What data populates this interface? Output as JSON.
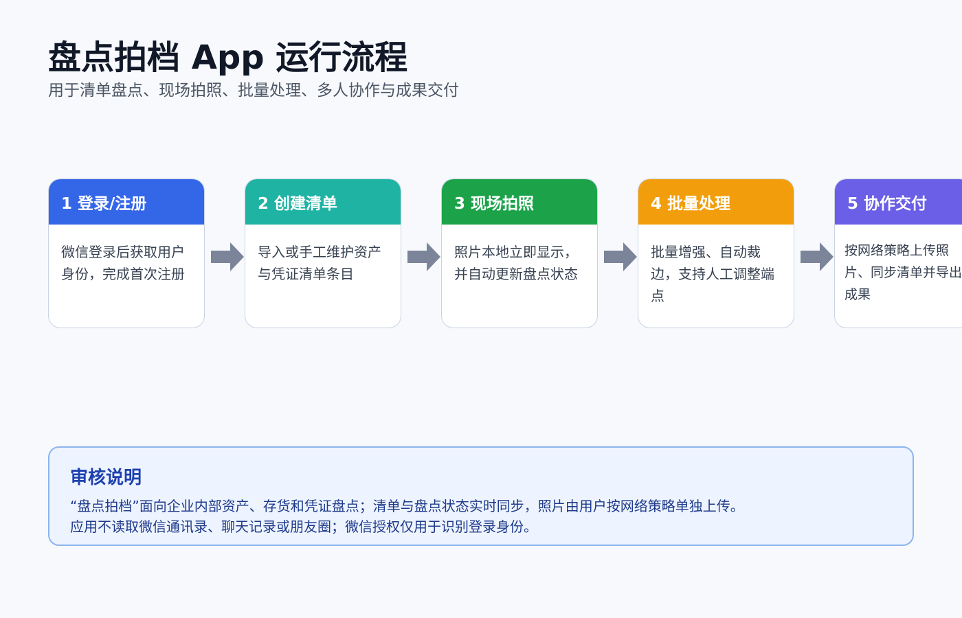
{
  "header": {
    "title": "盘点拍档 App 运行流程",
    "subtitle": "用于清单盘点、现场拍照、批量处理、多人协作与成果交付"
  },
  "steps": [
    {
      "label": "1 登录/注册",
      "desc": "微信登录后获取用户身份，完成首次注册",
      "color": "#3466e8"
    },
    {
      "label": "2 创建清单",
      "desc": "导入或手工维护资产与凭证清单条目",
      "color": "#1fb3a3"
    },
    {
      "label": "3 现场拍照",
      "desc": "照片本地立即显示，并自动更新盘点状态",
      "color": "#1ca34a"
    },
    {
      "label": "4 批量处理",
      "desc": "批量增强、自动裁边，支持人工调整端点",
      "color": "#f29e0c"
    },
    {
      "label": "5 协作交付",
      "desc": "按网络策略上传照片、同步清单并导出成果",
      "color": "#6a5fe6"
    }
  ],
  "arrow_color": "#7b8499",
  "review": {
    "title": "审核说明",
    "line1": "“盘点拍档”面向企业内部资产、存货和凭证盘点；清单与盘点状态实时同步，照片由用户按网络策略单独上传。",
    "line2": "应用不读取微信通讯录、聊天记录或朋友圈；微信授权仅用于识别登录身份。"
  }
}
